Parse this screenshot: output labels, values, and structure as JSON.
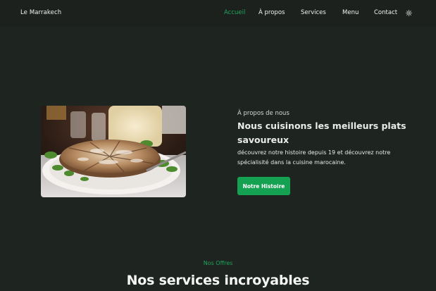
{
  "navbar": {
    "brand": "Le Marrakech",
    "links": [
      {
        "label": "Accueil",
        "active": true
      },
      {
        "label": "À propos",
        "active": false
      },
      {
        "label": "Services",
        "active": false
      },
      {
        "label": "Menu",
        "active": false
      },
      {
        "label": "Contact",
        "active": false
      }
    ],
    "theme_icon": "sun-icon"
  },
  "about": {
    "eyebrow": "À propos de nous",
    "title": "Nous cuisinons les meilleurs plats savoureux",
    "description": "découvrez notre histoire depuis 19 et découvrez notre spécialisité dans la cuisine marocaine.",
    "button_label": "Notre Histoire",
    "image": "pastilla-dish-photo"
  },
  "services": {
    "eyebrow": "Nos Offres",
    "title": "Nos services incroyables"
  },
  "colors": {
    "background": "#1e2420",
    "accent": "#15a152",
    "text": "#e9ece9"
  }
}
